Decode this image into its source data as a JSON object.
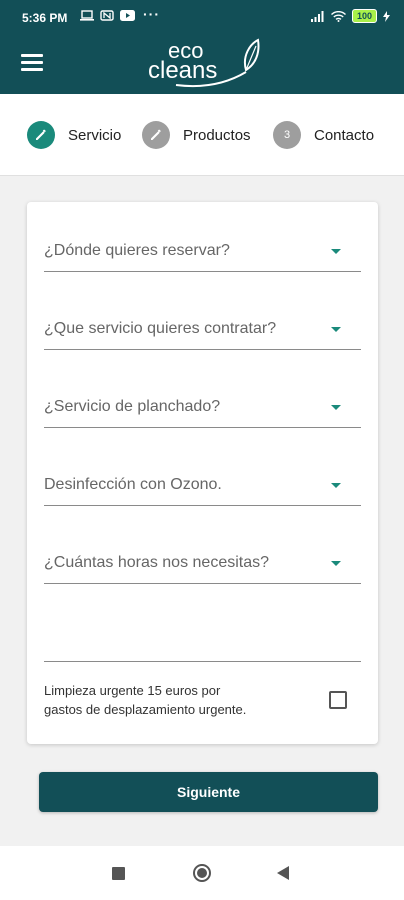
{
  "status_bar": {
    "time": "5:36 PM",
    "battery": "100"
  },
  "app": {
    "logo_line1": "eco",
    "logo_line2": "cleans"
  },
  "stepper": {
    "steps": [
      {
        "label": "Servicio",
        "icon": "pencil-icon",
        "state": "active"
      },
      {
        "label": "Productos",
        "icon": "pencil-icon",
        "state": "inactive"
      },
      {
        "label": "Contacto",
        "number": "3",
        "state": "inactive"
      }
    ]
  },
  "form": {
    "fields": [
      {
        "text": "¿Dónde quieres reservar?"
      },
      {
        "text": "¿Que servicio quieres contratar?"
      },
      {
        "text": "¿Servicio de planchado?"
      },
      {
        "text": "Desinfección con Ozono."
      },
      {
        "text": "¿Cuántas horas nos necesitas?"
      }
    ],
    "urgent_line1": "Limpieza urgente 15 euros por",
    "urgent_line2": "gastos de desplazamiento urgente.",
    "urgent_checked": false
  },
  "actions": {
    "next_label": "Siguiente"
  },
  "colors": {
    "brand_dark": "#124f57",
    "accent_teal": "#1a8a7b",
    "inactive_grey": "#9e9e9e"
  }
}
